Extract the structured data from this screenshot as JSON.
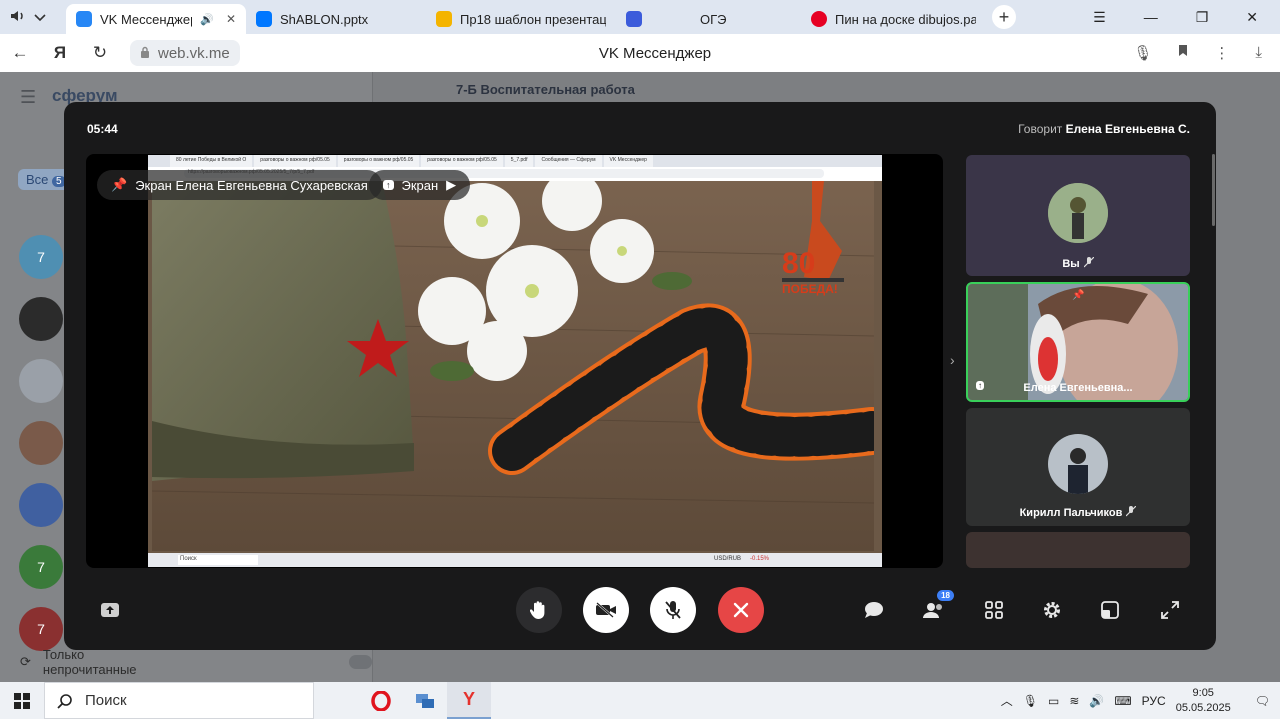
{
  "browser": {
    "tabs": [
      {
        "title": "VK Мессенджер",
        "active": true,
        "favicon_color": "#2787f5"
      },
      {
        "title": "ShABLON.pptx",
        "active": false,
        "favicon_color": "#0077ff"
      },
      {
        "title": "Пр18 шаблон презентаци",
        "active": false,
        "favicon_color": "#f4b400"
      },
      {
        "title": "ОГЭ",
        "active": false,
        "favicon_color": "#3b5bdb"
      },
      {
        "title": "Пин на доске dibujos.para",
        "active": false,
        "favicon_color": "#e60023"
      }
    ],
    "url": "web.vk.me",
    "page_title": "VK Мессенджер"
  },
  "vk": {
    "logo": "сферум",
    "filter_all": "Все",
    "filter_count": "5",
    "avatar_letter": "7",
    "chat_title": "7-Б Воспитательная работа",
    "unread_toggle_label": "Только непрочитанные"
  },
  "call": {
    "timer": "05:44",
    "speaking_label": "Говорит",
    "speaking_name": "Елена Евгеньевна С.",
    "screen_owner_label": "Экран Елена Евгеньевна Сухаревская",
    "screen_badge": "Экран",
    "shared_screen": {
      "tabs": [
        "80 летие Победы в Великой О",
        "разговоры о важном рф/05.05",
        "разговоры о важном рф/05.05",
        "разговоры о важном рф/05.05",
        "5_7.pdf",
        "Сообщения — Сферум",
        "VK Мессенджер"
      ],
      "url": "https://разговорыоважном.рф/05.05.2025/5_7/p/5_7.pdf",
      "badge_number": "80",
      "badge_text": "ПОБЕДА!",
      "taskbar_search": "Поиск",
      "currency": "USD/RUB",
      "currency_change": "-0.15%"
    },
    "participants": [
      {
        "name": "Вы",
        "muted": true
      },
      {
        "name": "Елена Евгеньевна...",
        "active": true,
        "pinned": true
      },
      {
        "name": "Кирилл Пальчиков",
        "muted": true
      }
    ],
    "participants_count": "18"
  },
  "taskbar": {
    "search_placeholder": "Поиск",
    "language": "РУС",
    "time": "9:05",
    "date": "05.05.2025"
  }
}
